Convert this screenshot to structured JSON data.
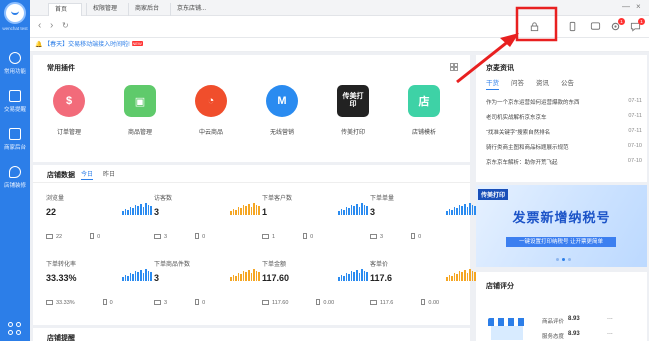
{
  "sidebar": {
    "user": "wenchat   test",
    "items": [
      {
        "label": "常用功能",
        "icon": "globe-icon"
      },
      {
        "label": "交易提醒",
        "icon": "basket-icon"
      },
      {
        "label": "商家后台",
        "icon": "chart-icon"
      },
      {
        "label": "店铺装修",
        "icon": "brush-icon"
      }
    ]
  },
  "tabs": [
    "首页",
    "权限管理",
    "商家后台",
    "京东店铺..."
  ],
  "notice": {
    "text": "【春天】交易移动端接入时间啦!",
    "new_badge": "NEW"
  },
  "plugins": {
    "title": "常用插件",
    "items": [
      {
        "label": "订单管理",
        "glyph": "$",
        "color": "#f26b7a"
      },
      {
        "label": "商品管理",
        "glyph": "▣",
        "color": "#5fca6b"
      },
      {
        "label": "中云商品",
        "glyph": "◔",
        "color": "#f04e2c"
      },
      {
        "label": "无线营销",
        "glyph": "M",
        "color": "#2a8bf0"
      },
      {
        "label": "传美打印",
        "glyph": "传美打印",
        "color": "#222222"
      },
      {
        "label": "店铺模析",
        "glyph": "店",
        "color": "#3ed2a6"
      }
    ]
  },
  "shop_data": {
    "title": "店铺数据",
    "tabs": [
      "今日",
      "昨日"
    ],
    "stats": [
      {
        "name": "浏览量",
        "value": "22",
        "pc": "22",
        "mobile": "0",
        "color": "#2a8bf0"
      },
      {
        "name": "访客数",
        "value": "3",
        "pc": "3",
        "mobile": "0",
        "color": "#f5a623"
      },
      {
        "name": "下单客户数",
        "value": "1",
        "pc": "1",
        "mobile": "0",
        "color": "#2a8bf0"
      },
      {
        "name": "下单单量",
        "value": "3",
        "pc": "3",
        "mobile": "0",
        "color": "#2a8bf0"
      },
      {
        "name": "下单转化率",
        "value": "33.33%",
        "pc": "33.33%",
        "mobile": "0",
        "color": "#2a8bf0"
      },
      {
        "name": "下单商品件数",
        "value": "3",
        "pc": "3",
        "mobile": "0",
        "color": "#f5a623"
      },
      {
        "name": "下单金额",
        "value": "117.60",
        "pc": "117.60",
        "mobile": "0.00",
        "color": "#2a8bf0"
      },
      {
        "name": "客单价",
        "value": "117.6",
        "pc": "117.6",
        "mobile": "0.00",
        "color": "#f5a623"
      }
    ]
  },
  "shop_remind": {
    "title": "店铺提醒"
  },
  "news": {
    "title": "京麦资讯",
    "tabs": [
      "干货",
      "问答",
      "资讯",
      "公告"
    ],
    "rows": [
      {
        "text": "作为一个京东运营如何运营爆款的东西",
        "date": "07-11"
      },
      {
        "text": "老司机实战解析京东京车",
        "date": "07-11"
      },
      {
        "text": "“找准关键字”搜索自然排名",
        "date": "07-11"
      },
      {
        "text": "骑行类商主图和商品标题展示规范",
        "date": "07-10"
      },
      {
        "text": "京东京车解析：助你开荒飞起",
        "date": "07-10"
      }
    ]
  },
  "banner": {
    "tag": "传美打印",
    "title": "发票新增纳税号",
    "sub": "一键设置打印纳税号  让开票更简单"
  },
  "rating": {
    "title": "店铺评分",
    "rows": [
      {
        "label": "商品评价",
        "value": "8.93"
      },
      {
        "label": "服务态度",
        "value": "8.93"
      }
    ],
    "more": "..."
  }
}
